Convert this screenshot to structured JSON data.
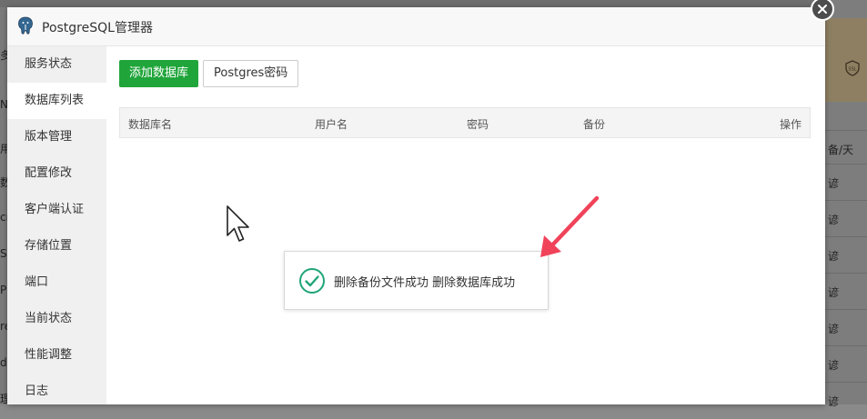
{
  "modal": {
    "title": "PostgreSQL管理器"
  },
  "sidebar": {
    "items": [
      {
        "label": "服务状态"
      },
      {
        "label": "数据库列表"
      },
      {
        "label": "版本管理"
      },
      {
        "label": "配置修改"
      },
      {
        "label": "客户端认证"
      },
      {
        "label": "存储位置"
      },
      {
        "label": "端口"
      },
      {
        "label": "当前状态"
      },
      {
        "label": "性能调整"
      },
      {
        "label": "日志"
      }
    ],
    "active_index": 1
  },
  "toolbar": {
    "add_label": "添加数据库",
    "password_label": "Postgres密码"
  },
  "table": {
    "columns": [
      "数据库名",
      "用户名",
      "密码",
      "备份",
      "操作"
    ]
  },
  "toast": {
    "message": "删除备份文件成功 删除数据库成功"
  },
  "background": {
    "header_unit": "备/天",
    "cell_text": "谚",
    "left_chars": [
      "多",
      "N",
      "用",
      "数",
      "cr",
      "S",
      "P",
      "re",
      "di",
      "理"
    ]
  },
  "colors": {
    "primary": "#20a53a",
    "success_icon": "#20a57a",
    "annotation_arrow": "#f0435a"
  }
}
